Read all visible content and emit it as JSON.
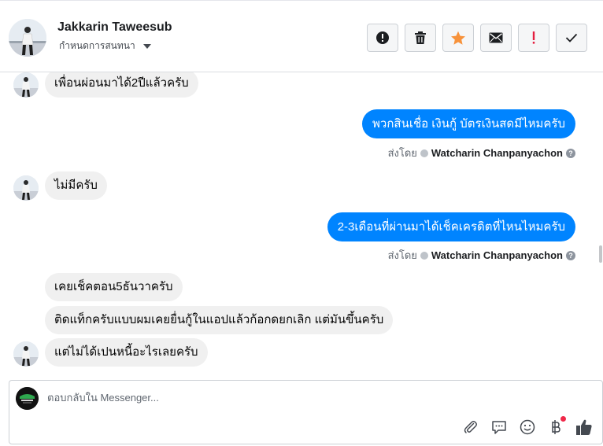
{
  "header": {
    "contact_name": "Jakkarin Taweesub",
    "assign_label": "กำหนดการสนทนา"
  },
  "toolbar": {
    "buttons": [
      {
        "name": "spam-button",
        "icon": "alert-circle-icon"
      },
      {
        "name": "delete-button",
        "icon": "trash-icon"
      },
      {
        "name": "star-button",
        "icon": "star-icon"
      },
      {
        "name": "mark-unread-button",
        "icon": "envelope-icon"
      },
      {
        "name": "follow-up-button",
        "icon": "exclamation-icon"
      },
      {
        "name": "mark-done-button",
        "icon": "checkmark-icon"
      }
    ]
  },
  "messages": [
    {
      "side": "in",
      "text": "เพื่อนผ่อนมาได้2ปีแล้วครับ"
    },
    {
      "side": "out",
      "text": "พวกสินเชื่อ เงินกู้ บัตรเงินสดมีไหมครับ",
      "sent_by_label": "ส่งโดย",
      "sender": "Watcharin Chanpanyachon"
    },
    {
      "side": "in",
      "text": "ไม่มีครับ"
    },
    {
      "side": "out",
      "text": "2-3เดือนที่ผ่านมาได้เช็คเครดิตที่ไหนไหมครับ",
      "sent_by_label": "ส่งโดย",
      "sender": "Watcharin Chanpanyachon"
    },
    {
      "side": "in",
      "text": "เคยเช็คตอน5ธันวาครับ"
    },
    {
      "side": "in",
      "text": "ติดแท็กครับแบบผมเคยยื่นกู้ในแอปแล้วก้อกดยกเลิก แต่มันขึ้นครับ"
    },
    {
      "side": "in",
      "text": "แต่ไม่ได้เปนหนี้อะไรเลยครับ"
    }
  ],
  "composer": {
    "placeholder": "ตอบกลับใน Messenger...",
    "tools": [
      "paperclip-icon",
      "speech-bubble-icon",
      "smiley-icon",
      "baht-icon",
      "thumbs-up-icon"
    ],
    "accent": "#0084ff",
    "notification_color": "#f02849"
  }
}
